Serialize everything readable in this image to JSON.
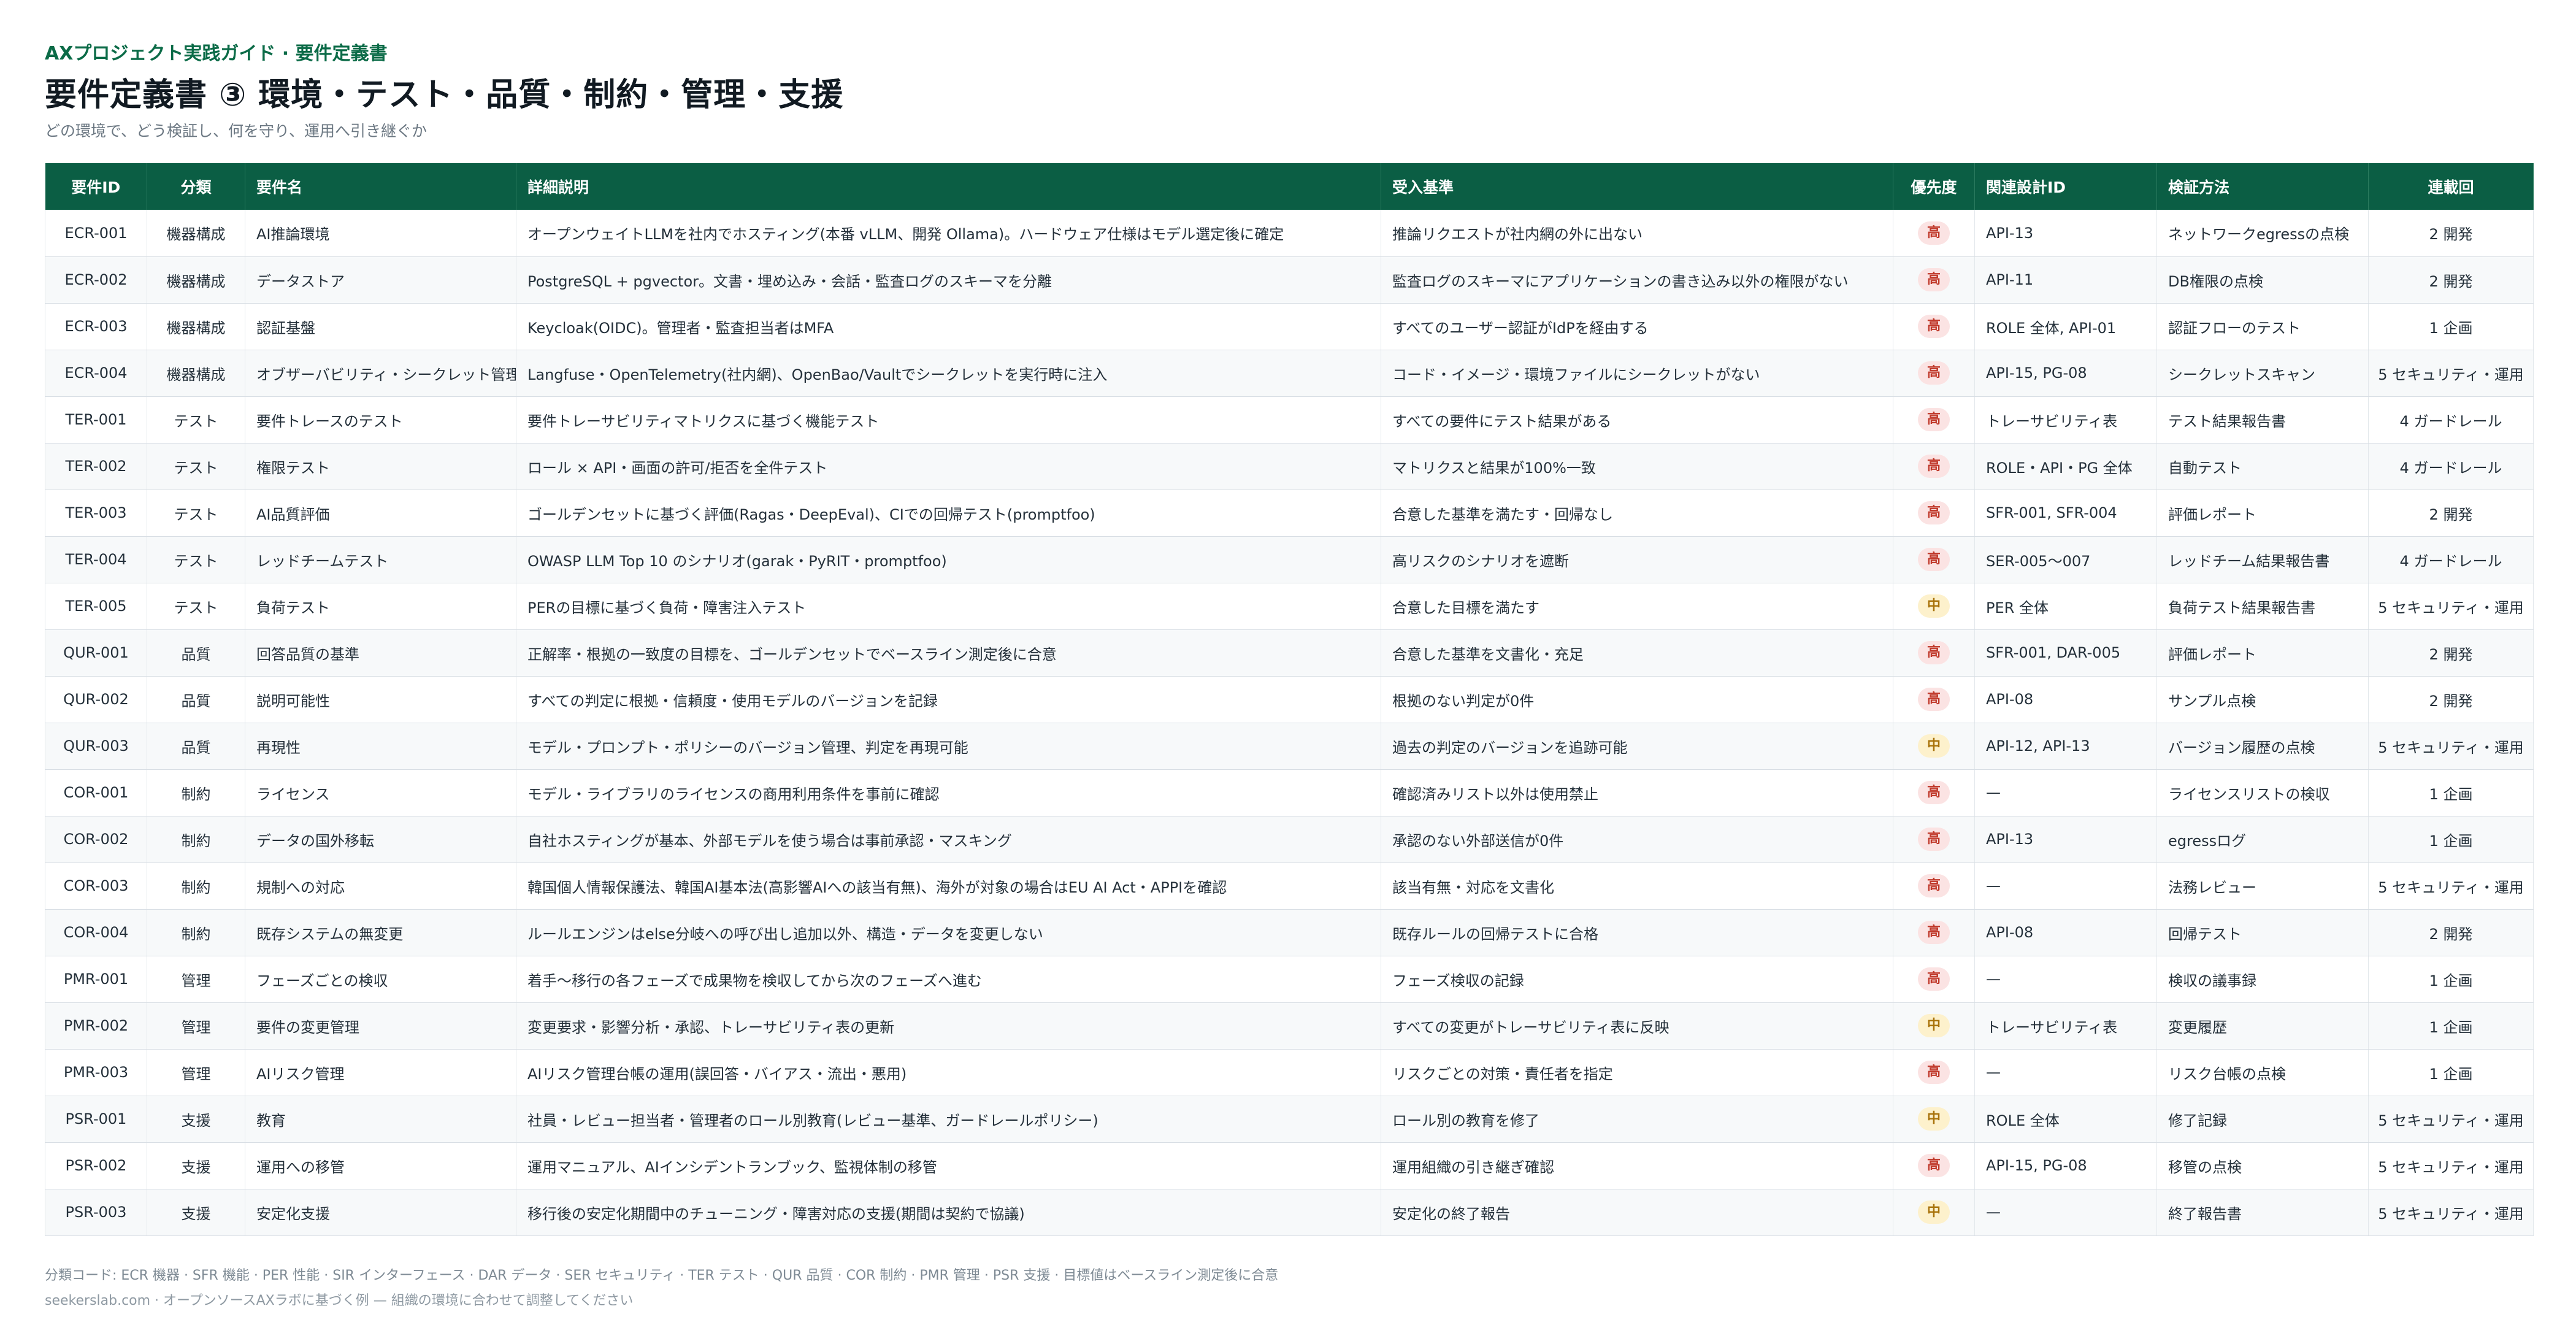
{
  "header": {
    "eyebrow": "AXプロジェクト実践ガイド · 要件定義書",
    "title": "要件定義書 ③ 環境・テスト・品質・制約・管理・支援",
    "subtitle": "どの環境で、どう検証し、何を守り、運用へ引き継ぐか"
  },
  "table": {
    "columns": [
      "要件ID",
      "分類",
      "要件名",
      "詳細説明",
      "受入基準",
      "優先度",
      "関連設計ID",
      "検証方法",
      "連載回"
    ],
    "rows": [
      {
        "id": "ECR-001",
        "category": "機器構成",
        "name": "AI推論環境",
        "detail": "オープンウェイトLLMを社内でホスティング(本番 vLLM、開発 Ollama)。ハードウェア仕様はモデル選定後に確定",
        "acceptance": "推論リクエストが社内網の外に出ない",
        "priority": "高",
        "level": "high",
        "design": "API-13",
        "method": "ネットワークegressの点検",
        "episode": "2 開発"
      },
      {
        "id": "ECR-002",
        "category": "機器構成",
        "name": "データストア",
        "detail": "PostgreSQL + pgvector。文書・埋め込み・会話・監査ログのスキーマを分離",
        "acceptance": "監査ログのスキーマにアプリケーションの書き込み以外の権限がない",
        "priority": "高",
        "level": "high",
        "design": "API-11",
        "method": "DB権限の点検",
        "episode": "2 開発"
      },
      {
        "id": "ECR-003",
        "category": "機器構成",
        "name": "認証基盤",
        "detail": "Keycloak(OIDC)。管理者・監査担当者はMFA",
        "acceptance": "すべてのユーザー認証がIdPを経由する",
        "priority": "高",
        "level": "high",
        "design": "ROLE 全体, API-01",
        "method": "認証フローのテスト",
        "episode": "1 企画"
      },
      {
        "id": "ECR-004",
        "category": "機器構成",
        "name": "オブザーバビリティ・シークレット管理",
        "detail": "Langfuse・OpenTelemetry(社内網)、OpenBao/Vaultでシークレットを実行時に注入",
        "acceptance": "コード・イメージ・環境ファイルにシークレットがない",
        "priority": "高",
        "level": "high",
        "design": "API-15, PG-08",
        "method": "シークレットスキャン",
        "episode": "5 セキュリティ・運用"
      },
      {
        "id": "TER-001",
        "category": "テスト",
        "name": "要件トレースのテスト",
        "detail": "要件トレーサビリティマトリクスに基づく機能テスト",
        "acceptance": "すべての要件にテスト結果がある",
        "priority": "高",
        "level": "high",
        "design": "トレーサビリティ表",
        "method": "テスト結果報告書",
        "episode": "4 ガードレール"
      },
      {
        "id": "TER-002",
        "category": "テスト",
        "name": "権限テスト",
        "detail": "ロール × API・画面の許可/拒否を全件テスト",
        "acceptance": "マトリクスと結果が100%一致",
        "priority": "高",
        "level": "high",
        "design": "ROLE・API・PG 全体",
        "method": "自動テスト",
        "episode": "4 ガードレール"
      },
      {
        "id": "TER-003",
        "category": "テスト",
        "name": "AI品質評価",
        "detail": "ゴールデンセットに基づく評価(Ragas・DeepEval)、CIでの回帰テスト(promptfoo)",
        "acceptance": "合意した基準を満たす・回帰なし",
        "priority": "高",
        "level": "high",
        "design": "SFR-001, SFR-004",
        "method": "評価レポート",
        "episode": "2 開発"
      },
      {
        "id": "TER-004",
        "category": "テスト",
        "name": "レッドチームテスト",
        "detail": "OWASP LLM Top 10 のシナリオ(garak・PyRIT・promptfoo)",
        "acceptance": "高リスクのシナリオを遮断",
        "priority": "高",
        "level": "high",
        "design": "SER-005～007",
        "method": "レッドチーム結果報告書",
        "episode": "4 ガードレール"
      },
      {
        "id": "TER-005",
        "category": "テスト",
        "name": "負荷テスト",
        "detail": "PERの目標に基づく負荷・障害注入テスト",
        "acceptance": "合意した目標を満たす",
        "priority": "中",
        "level": "mid",
        "design": "PER 全体",
        "method": "負荷テスト結果報告書",
        "episode": "5 セキュリティ・運用"
      },
      {
        "id": "QUR-001",
        "category": "品質",
        "name": "回答品質の基準",
        "detail": "正解率・根拠の一致度の目標を、ゴールデンセットでベースライン測定後に合意",
        "acceptance": "合意した基準を文書化・充足",
        "priority": "高",
        "level": "high",
        "design": "SFR-001, DAR-005",
        "method": "評価レポート",
        "episode": "2 開発"
      },
      {
        "id": "QUR-002",
        "category": "品質",
        "name": "説明可能性",
        "detail": "すべての判定に根拠・信頼度・使用モデルのバージョンを記録",
        "acceptance": "根拠のない判定が0件",
        "priority": "高",
        "level": "high",
        "design": "API-08",
        "method": "サンプル点検",
        "episode": "2 開発"
      },
      {
        "id": "QUR-003",
        "category": "品質",
        "name": "再現性",
        "detail": "モデル・プロンプト・ポリシーのバージョン管理、判定を再現可能",
        "acceptance": "過去の判定のバージョンを追跡可能",
        "priority": "中",
        "level": "mid",
        "design": "API-12, API-13",
        "method": "バージョン履歴の点検",
        "episode": "5 セキュリティ・運用"
      },
      {
        "id": "COR-001",
        "category": "制約",
        "name": "ライセンス",
        "detail": "モデル・ライブラリのライセンスの商用利用条件を事前に確認",
        "acceptance": "確認済みリスト以外は使用禁止",
        "priority": "高",
        "level": "high",
        "design": "—",
        "method": "ライセンスリストの検収",
        "episode": "1 企画"
      },
      {
        "id": "COR-002",
        "category": "制約",
        "name": "データの国外移転",
        "detail": "自社ホスティングが基本、外部モデルを使う場合は事前承認・マスキング",
        "acceptance": "承認のない外部送信が0件",
        "priority": "高",
        "level": "high",
        "design": "API-13",
        "method": "egressログ",
        "episode": "1 企画"
      },
      {
        "id": "COR-003",
        "category": "制約",
        "name": "規制への対応",
        "detail": "韓国個人情報保護法、韓国AI基本法(高影響AIへの該当有無)、海外が対象の場合はEU AI Act・APPIを確認",
        "acceptance": "該当有無・対応を文書化",
        "priority": "高",
        "level": "high",
        "design": "—",
        "method": "法務レビュー",
        "episode": "5 セキュリティ・運用"
      },
      {
        "id": "COR-004",
        "category": "制約",
        "name": "既存システムの無変更",
        "detail": "ルールエンジンはelse分岐への呼び出し追加以外、構造・データを変更しない",
        "acceptance": "既存ルールの回帰テストに合格",
        "priority": "高",
        "level": "high",
        "design": "API-08",
        "method": "回帰テスト",
        "episode": "2 開発"
      },
      {
        "id": "PMR-001",
        "category": "管理",
        "name": "フェーズごとの検収",
        "detail": "着手～移行の各フェーズで成果物を検収してから次のフェーズへ進む",
        "acceptance": "フェーズ検収の記録",
        "priority": "高",
        "level": "high",
        "design": "—",
        "method": "検収の議事録",
        "episode": "1 企画"
      },
      {
        "id": "PMR-002",
        "category": "管理",
        "name": "要件の変更管理",
        "detail": "変更要求・影響分析・承認、トレーサビリティ表の更新",
        "acceptance": "すべての変更がトレーサビリティ表に反映",
        "priority": "中",
        "level": "mid",
        "design": "トレーサビリティ表",
        "method": "変更履歴",
        "episode": "1 企画"
      },
      {
        "id": "PMR-003",
        "category": "管理",
        "name": "AIリスク管理",
        "detail": "AIリスク管理台帳の運用(誤回答・バイアス・流出・悪用)",
        "acceptance": "リスクごとの対策・責任者を指定",
        "priority": "高",
        "level": "high",
        "design": "—",
        "method": "リスク台帳の点検",
        "episode": "1 企画"
      },
      {
        "id": "PSR-001",
        "category": "支援",
        "name": "教育",
        "detail": "社員・レビュー担当者・管理者のロール別教育(レビュー基準、ガードレールポリシー)",
        "acceptance": "ロール別の教育を修了",
        "priority": "中",
        "level": "mid",
        "design": "ROLE 全体",
        "method": "修了記録",
        "episode": "5 セキュリティ・運用"
      },
      {
        "id": "PSR-002",
        "category": "支援",
        "name": "運用への移管",
        "detail": "運用マニュアル、AIインシデントランブック、監視体制の移管",
        "acceptance": "運用組織の引き継ぎ確認",
        "priority": "高",
        "level": "high",
        "design": "API-15, PG-08",
        "method": "移管の点検",
        "episode": "5 セキュリティ・運用"
      },
      {
        "id": "PSR-003",
        "category": "支援",
        "name": "安定化支援",
        "detail": "移行後の安定化期間中のチューニング・障害対応の支援(期間は契約で協議)",
        "acceptance": "安定化の終了報告",
        "priority": "中",
        "level": "mid",
        "design": "—",
        "method": "終了報告書",
        "episode": "5 セキュリティ・運用"
      }
    ]
  },
  "footer": {
    "legend": "分類コード: ECR 機器 · SFR 機能 · PER 性能 · SIR インターフェース · DAR データ · SER セキュリティ · TER テスト · QUR 品質 · COR 制約 · PMR 管理 · PSR 支援 · 目標値はベースライン測定後に合意",
    "source": "seekerslab.com · オープンソースAXラボに基づく例 — 組織の環境に合わせて調整してください"
  },
  "colors": {
    "header_bg": "#0b5e44",
    "accent": "#0b6b47",
    "high_badge_bg": "#fbe3e3",
    "high_badge_fg": "#c0392b",
    "mid_badge_bg": "#fdf1cc",
    "mid_badge_fg": "#a8720a"
  }
}
